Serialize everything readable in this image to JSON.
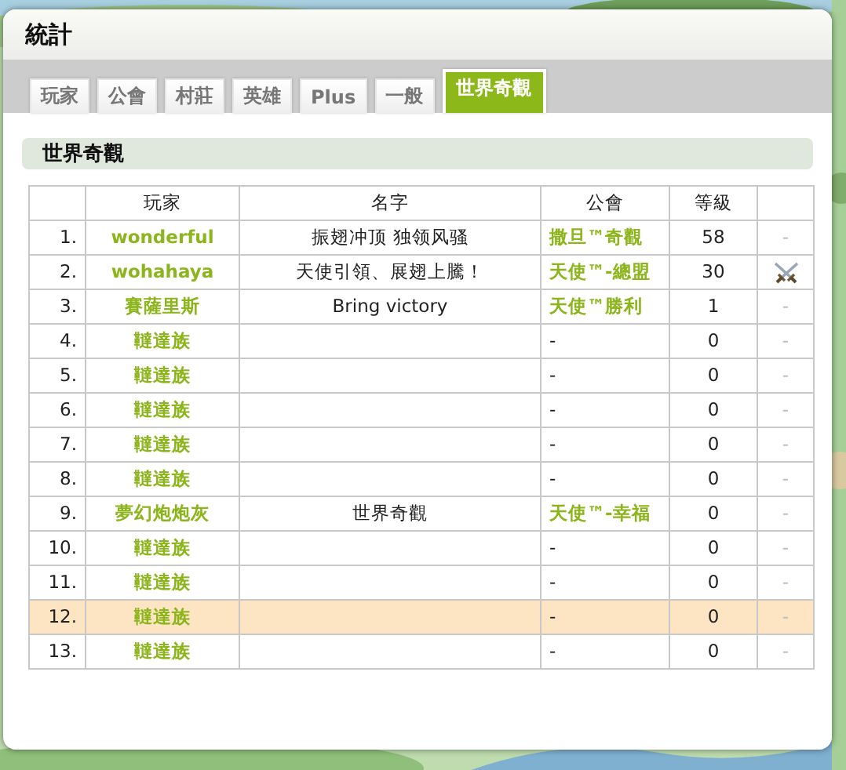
{
  "window": {
    "title": "統計"
  },
  "tabs": [
    {
      "label": "玩家",
      "selected": false
    },
    {
      "label": "公會",
      "selected": false
    },
    {
      "label": "村莊",
      "selected": false
    },
    {
      "label": "英雄",
      "selected": false
    },
    {
      "label": "Plus",
      "selected": false
    },
    {
      "label": "一般",
      "selected": false
    },
    {
      "label": "世界奇觀",
      "selected": true
    }
  ],
  "section": {
    "title": "世界奇觀"
  },
  "table": {
    "columns": [
      "",
      "玩家",
      "名字",
      "公會",
      "等級",
      ""
    ],
    "rows": [
      {
        "rank": "1.",
        "player": "wonderful",
        "name": "振翅冲顶 独领风骚",
        "guild": "撒旦™奇觀",
        "guild_linked": true,
        "level": "58",
        "kind": "dash",
        "action": "-",
        "selected": false
      },
      {
        "rank": "2.",
        "player": "wohahaya",
        "name": "天使引領、展翅上騰！",
        "guild": "天使™-總盟",
        "guild_linked": true,
        "level": "30",
        "kind": "attack",
        "selected": false
      },
      {
        "rank": "3.",
        "player": "賽薩里斯",
        "name": "Bring victory",
        "guild": "天使™勝利",
        "guild_linked": true,
        "level": "1",
        "kind": "dash",
        "action": "-",
        "selected": false
      },
      {
        "rank": "4.",
        "player": "韃達族",
        "name": "",
        "guild": "-",
        "guild_linked": false,
        "level": "0",
        "kind": "dash",
        "action": "-",
        "selected": false
      },
      {
        "rank": "5.",
        "player": "韃達族",
        "name": "",
        "guild": "-",
        "guild_linked": false,
        "level": "0",
        "kind": "dash",
        "action": "-",
        "selected": false
      },
      {
        "rank": "6.",
        "player": "韃達族",
        "name": "",
        "guild": "-",
        "guild_linked": false,
        "level": "0",
        "kind": "dash",
        "action": "-",
        "selected": false
      },
      {
        "rank": "7.",
        "player": "韃達族",
        "name": "",
        "guild": "-",
        "guild_linked": false,
        "level": "0",
        "kind": "dash",
        "action": "-",
        "selected": false
      },
      {
        "rank": "8.",
        "player": "韃達族",
        "name": "",
        "guild": "-",
        "guild_linked": false,
        "level": "0",
        "kind": "dash",
        "action": "-",
        "selected": false
      },
      {
        "rank": "9.",
        "player": "夢幻炮炮灰",
        "name": "世界奇觀",
        "guild": "天使™-幸福",
        "guild_linked": true,
        "level": "0",
        "kind": "dash",
        "action": "-",
        "selected": false
      },
      {
        "rank": "10.",
        "player": "韃達族",
        "name": "",
        "guild": "-",
        "guild_linked": false,
        "level": "0",
        "kind": "dash",
        "action": "-",
        "selected": false
      },
      {
        "rank": "11.",
        "player": "韃達族",
        "name": "",
        "guild": "-",
        "guild_linked": false,
        "level": "0",
        "kind": "dash",
        "action": "-",
        "selected": false
      },
      {
        "rank": "12.",
        "player": "韃達族",
        "name": "",
        "guild": "-",
        "guild_linked": false,
        "level": "0",
        "kind": "dash",
        "action": "-",
        "selected": true
      },
      {
        "rank": "13.",
        "player": "韃達族",
        "name": "",
        "guild": "-",
        "guild_linked": false,
        "level": "0",
        "kind": "dash",
        "action": "-",
        "selected": false
      }
    ]
  }
}
